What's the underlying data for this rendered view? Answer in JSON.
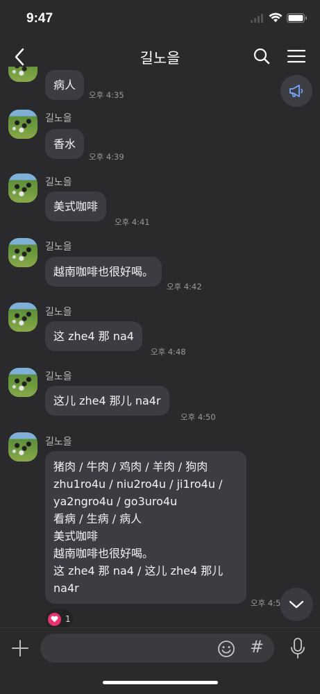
{
  "status_bar": {
    "time": "9:47"
  },
  "header": {
    "title": "길노을"
  },
  "messages": [
    {
      "sender": "",
      "text": "病人",
      "time": "오후 4:35"
    },
    {
      "sender": "길노을",
      "text": "香水",
      "time": "오후 4:39"
    },
    {
      "sender": "길노을",
      "text": "美式咖啡",
      "time": "오후 4:41"
    },
    {
      "sender": "길노을",
      "text": "越南咖啡也很好喝。",
      "time": "오후 4:42"
    },
    {
      "sender": "길노을",
      "text": "这 zhe4 那 na4",
      "time": "오후 4:48"
    },
    {
      "sender": "길노을",
      "text": "这儿 zhe4 那儿 na4r",
      "time": "오후 4:50"
    },
    {
      "sender": "길노을",
      "text": "猪肉 / 牛肉 / 鸡肉 / 羊肉 / 狗肉\nzhu1ro4u / niu2ro4u / ji1ro4u /\nya2ngro4u / go3uro4u\n看病 / 生病 / 病人\n美式咖啡\n越南咖啡也很好喝。\n这 zhe4 那 na4 / 这儿 zhe4 那儿\nna4r",
      "time": "오후 4:5"
    }
  ],
  "reaction": {
    "count": "1"
  },
  "composer": {
    "placeholder": "",
    "hash_label": "#"
  },
  "colors": {
    "background": "#2a2a2c",
    "bubble": "#3c3d42",
    "heart": "#e8336f"
  }
}
